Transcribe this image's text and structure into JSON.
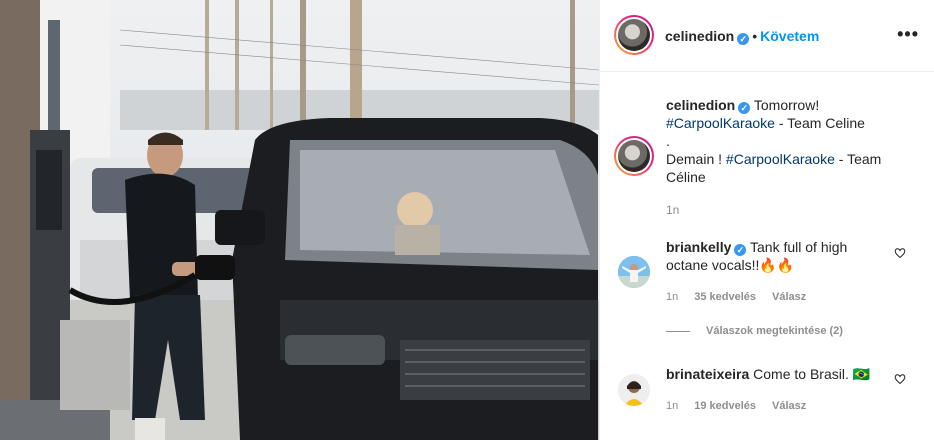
{
  "post": {
    "username": "celinedion",
    "verified_mark": "✓",
    "dot": "•",
    "follow_label": "Követem",
    "more_label": "•••"
  },
  "caption": {
    "username": "celinedion",
    "line1_text": "Tomorrow!",
    "line2_hashtag": "#CarpoolKaraoke",
    "line2_text": " - Team Celine",
    "line3": ".",
    "line4_text": "Demain ! ",
    "line4_hashtag": "#CarpoolKaraoke",
    "line4_text2": " - Team",
    "line5": "Céline",
    "time": "1n"
  },
  "comments": [
    {
      "username": "briankelly",
      "verified": true,
      "text": "Tank full of high octane vocals!!🔥🔥",
      "time": "1n",
      "likes": "35 kedvelés",
      "reply": "Válasz",
      "view_replies": "Válaszok megtekintése (2)"
    },
    {
      "username": "brinateixeira",
      "verified": false,
      "text": "Come to Brasil. 🇧🇷",
      "time": "1n",
      "likes": "19 kedvelés",
      "reply": "Válasz"
    }
  ],
  "icons": {
    "more": "ellipsis-icon",
    "heart": "heart-outline-icon",
    "verified": "verified-badge-icon"
  },
  "colors": {
    "link_blue": "#0095f6",
    "hashtag": "#00376b",
    "muted": "#8e8e8e",
    "verified": "#3897f0"
  }
}
